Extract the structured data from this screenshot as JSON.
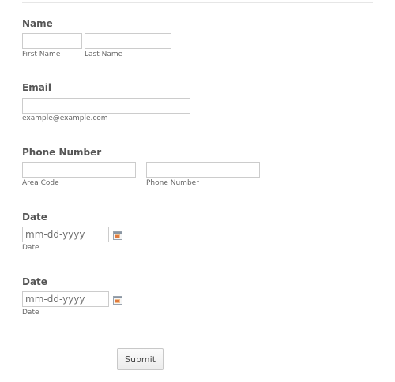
{
  "name_field": {
    "label": "Name",
    "first_sublabel": "First Name",
    "last_sublabel": "Last Name",
    "first_value": "",
    "last_value": ""
  },
  "email_field": {
    "label": "Email",
    "value": "",
    "sublabel": "example@example.com"
  },
  "phone_field": {
    "label": "Phone Number",
    "separator": "-",
    "area_value": "",
    "number_value": "",
    "area_sublabel": "Area Code",
    "number_sublabel": "Phone Number"
  },
  "date_field_1": {
    "label": "Date",
    "placeholder": "mm-dd-yyyy",
    "value": "",
    "sublabel": "Date",
    "icon": "calendar-icon"
  },
  "date_field_2": {
    "label": "Date",
    "placeholder": "mm-dd-yyyy",
    "value": "",
    "sublabel": "Date",
    "icon": "calendar-icon"
  },
  "submit": {
    "label": "Submit"
  }
}
